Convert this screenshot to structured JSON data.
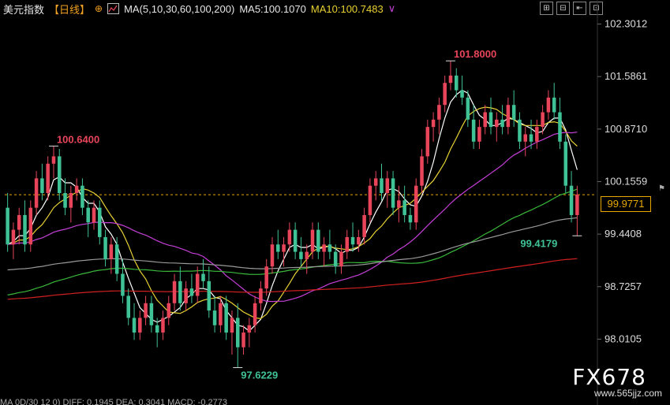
{
  "header": {
    "symbol": "美元指数",
    "timeframe": "【日线】",
    "cross_icon": "⊕",
    "ma_icon": "chart-icon",
    "ma_label": "MA(5,10,30,60,100,200)",
    "ma5": "MA5:100.1070",
    "ma10": "MA10:100.7483",
    "chevron": "∨"
  },
  "toolbar": [
    "⊞",
    "⊟",
    "⇤",
    "⊡"
  ],
  "watermark": {
    "brand": "FX678",
    "url": "www.565jjz.com"
  },
  "bottom_text": "MA 0D/30 12 0) DIFF: 0.1945 DEA: 0.3041 MACD: -0.2773",
  "current_price": "99.9771",
  "chart_data": {
    "type": "candlestick",
    "ylim": [
      97.5,
      102.5
    ],
    "y_ticks": [
      "102.3012",
      "101.5861",
      "100.8710",
      "100.1559",
      "99.4408",
      "98.7257",
      "98.0105"
    ],
    "annotations": [
      {
        "text": "100.6400",
        "value": 100.64
      },
      {
        "text": "101.8000",
        "value": 101.8
      },
      {
        "text": "97.6229",
        "value": 97.6229
      },
      {
        "text": "99.4179",
        "value": 99.4179
      }
    ],
    "ohlc": [
      [
        99.8,
        100.0,
        99.2,
        99.3
      ],
      [
        99.3,
        99.6,
        99.1,
        99.5
      ],
      [
        99.5,
        99.8,
        99.3,
        99.7
      ],
      [
        99.7,
        99.9,
        99.2,
        99.3
      ],
      [
        99.3,
        99.9,
        99.2,
        99.8
      ],
      [
        99.8,
        100.3,
        99.7,
        100.2
      ],
      [
        100.2,
        100.4,
        99.9,
        100.0
      ],
      [
        100.0,
        100.5,
        99.9,
        100.4
      ],
      [
        100.4,
        100.64,
        100.2,
        100.5
      ],
      [
        100.5,
        100.6,
        99.9,
        100.0
      ],
      [
        100.0,
        100.2,
        99.7,
        99.8
      ],
      [
        99.8,
        100.1,
        99.6,
        100.0
      ],
      [
        100.0,
        100.2,
        99.9,
        100.1
      ],
      [
        100.1,
        100.2,
        99.7,
        99.8
      ],
      [
        99.8,
        99.9,
        99.4,
        99.6
      ],
      [
        99.6,
        99.9,
        99.5,
        99.8
      ],
      [
        99.8,
        99.9,
        99.3,
        99.4
      ],
      [
        99.4,
        99.5,
        99.0,
        99.1
      ],
      [
        99.1,
        99.4,
        98.9,
        99.3
      ],
      [
        99.3,
        99.4,
        98.8,
        98.9
      ],
      [
        98.9,
        99.1,
        98.5,
        98.6
      ],
      [
        98.6,
        98.7,
        98.2,
        98.3
      ],
      [
        98.3,
        98.5,
        98.0,
        98.1
      ],
      [
        98.1,
        98.4,
        98.0,
        98.3
      ],
      [
        98.3,
        98.6,
        98.2,
        98.5
      ],
      [
        98.5,
        98.6,
        98.1,
        98.2
      ],
      [
        98.2,
        98.3,
        97.9,
        98.1
      ],
      [
        98.1,
        98.4,
        98.0,
        98.3
      ],
      [
        98.3,
        98.6,
        98.2,
        98.5
      ],
      [
        98.5,
        98.9,
        98.4,
        98.8
      ],
      [
        98.8,
        99.0,
        98.4,
        98.5
      ],
      [
        98.5,
        98.8,
        98.4,
        98.7
      ],
      [
        98.7,
        98.9,
        98.5,
        98.6
      ],
      [
        98.6,
        99.0,
        98.5,
        98.9
      ],
      [
        98.9,
        99.1,
        98.7,
        98.8
      ],
      [
        98.8,
        99.0,
        98.3,
        98.4
      ],
      [
        98.4,
        98.6,
        98.1,
        98.2
      ],
      [
        98.2,
        98.6,
        98.1,
        98.5
      ],
      [
        98.5,
        98.6,
        98.0,
        98.1
      ],
      [
        98.1,
        98.4,
        97.8,
        98.3
      ],
      [
        98.3,
        98.5,
        97.6229,
        97.9
      ],
      [
        97.9,
        98.2,
        97.8,
        98.1
      ],
      [
        98.1,
        98.3,
        97.9,
        98.2
      ],
      [
        98.2,
        98.6,
        98.1,
        98.5
      ],
      [
        98.5,
        98.8,
        98.4,
        98.7
      ],
      [
        98.7,
        99.1,
        98.6,
        99.0
      ],
      [
        99.0,
        99.4,
        98.9,
        99.3
      ],
      [
        99.3,
        99.5,
        99.1,
        99.2
      ],
      [
        99.2,
        99.4,
        99.0,
        99.3
      ],
      [
        99.3,
        99.6,
        99.2,
        99.5
      ],
      [
        99.5,
        99.6,
        99.1,
        99.2
      ],
      [
        99.2,
        99.4,
        99.0,
        99.1
      ],
      [
        99.1,
        99.3,
        98.9,
        99.2
      ],
      [
        99.2,
        99.6,
        99.1,
        99.5
      ],
      [
        99.5,
        99.6,
        99.1,
        99.2
      ],
      [
        99.2,
        99.4,
        99.0,
        99.3
      ],
      [
        99.3,
        99.5,
        99.1,
        99.2
      ],
      [
        99.2,
        99.3,
        98.9,
        99.0
      ],
      [
        99.0,
        99.3,
        98.9,
        99.2
      ],
      [
        99.2,
        99.5,
        99.1,
        99.4
      ],
      [
        99.4,
        99.6,
        99.2,
        99.3
      ],
      [
        99.3,
        99.5,
        99.2,
        99.4
      ],
      [
        99.4,
        99.8,
        99.3,
        99.7
      ],
      [
        99.7,
        100.2,
        99.6,
        100.1
      ],
      [
        100.1,
        100.3,
        99.9,
        100.2
      ],
      [
        100.2,
        100.4,
        99.9,
        100.0
      ],
      [
        100.0,
        100.3,
        99.8,
        100.2
      ],
      [
        100.2,
        100.3,
        99.7,
        99.8
      ],
      [
        99.8,
        100.1,
        99.6,
        99.9
      ],
      [
        99.9,
        100.1,
        99.6,
        99.7
      ],
      [
        99.7,
        99.8,
        99.5,
        99.6
      ],
      [
        99.6,
        100.2,
        99.5,
        100.1
      ],
      [
        100.1,
        100.6,
        100.0,
        100.5
      ],
      [
        100.5,
        101.0,
        100.4,
        100.9
      ],
      [
        100.9,
        101.1,
        100.7,
        101.0
      ],
      [
        101.0,
        101.3,
        100.8,
        101.2
      ],
      [
        101.2,
        101.6,
        101.1,
        101.5
      ],
      [
        101.5,
        101.8,
        101.4,
        101.6
      ],
      [
        101.6,
        101.7,
        101.3,
        101.4
      ],
      [
        101.4,
        101.6,
        101.2,
        101.3
      ],
      [
        101.3,
        101.4,
        100.9,
        101.0
      ],
      [
        101.0,
        101.2,
        100.6,
        100.7
      ],
      [
        100.7,
        101.0,
        100.6,
        100.9
      ],
      [
        100.9,
        101.2,
        100.8,
        101.1
      ],
      [
        101.1,
        101.3,
        100.8,
        100.9
      ],
      [
        100.9,
        101.1,
        100.7,
        101.0
      ],
      [
        101.0,
        101.2,
        100.8,
        100.9
      ],
      [
        100.9,
        101.3,
        100.8,
        101.2
      ],
      [
        101.2,
        101.4,
        100.9,
        101.0
      ],
      [
        101.0,
        101.1,
        100.6,
        100.7
      ],
      [
        100.7,
        100.9,
        100.5,
        100.8
      ],
      [
        100.8,
        101.0,
        100.6,
        100.7
      ],
      [
        100.7,
        101.0,
        100.6,
        100.9
      ],
      [
        100.9,
        101.2,
        100.8,
        101.1
      ],
      [
        101.1,
        101.4,
        101.0,
        101.3
      ],
      [
        101.3,
        101.5,
        101.0,
        101.1
      ],
      [
        101.1,
        101.3,
        100.6,
        100.7
      ],
      [
        100.7,
        100.8,
        100.0,
        100.1
      ],
      [
        100.1,
        100.3,
        99.6,
        99.7
      ],
      [
        99.7,
        100.1,
        99.4179,
        99.98
      ]
    ],
    "ma_series": [
      {
        "name": "MA5",
        "color": "#ffffff"
      },
      {
        "name": "MA10",
        "color": "#e8d233"
      },
      {
        "name": "MA30",
        "color": "#c43fd6"
      },
      {
        "name": "MA60",
        "color": "#39b83a"
      },
      {
        "name": "MA100",
        "color": "#9a9a9a"
      },
      {
        "name": "MA200",
        "color": "#d02020"
      }
    ],
    "up_color": "#e8455a",
    "down_color": "#3fc295",
    "reference_line": 99.9771
  }
}
